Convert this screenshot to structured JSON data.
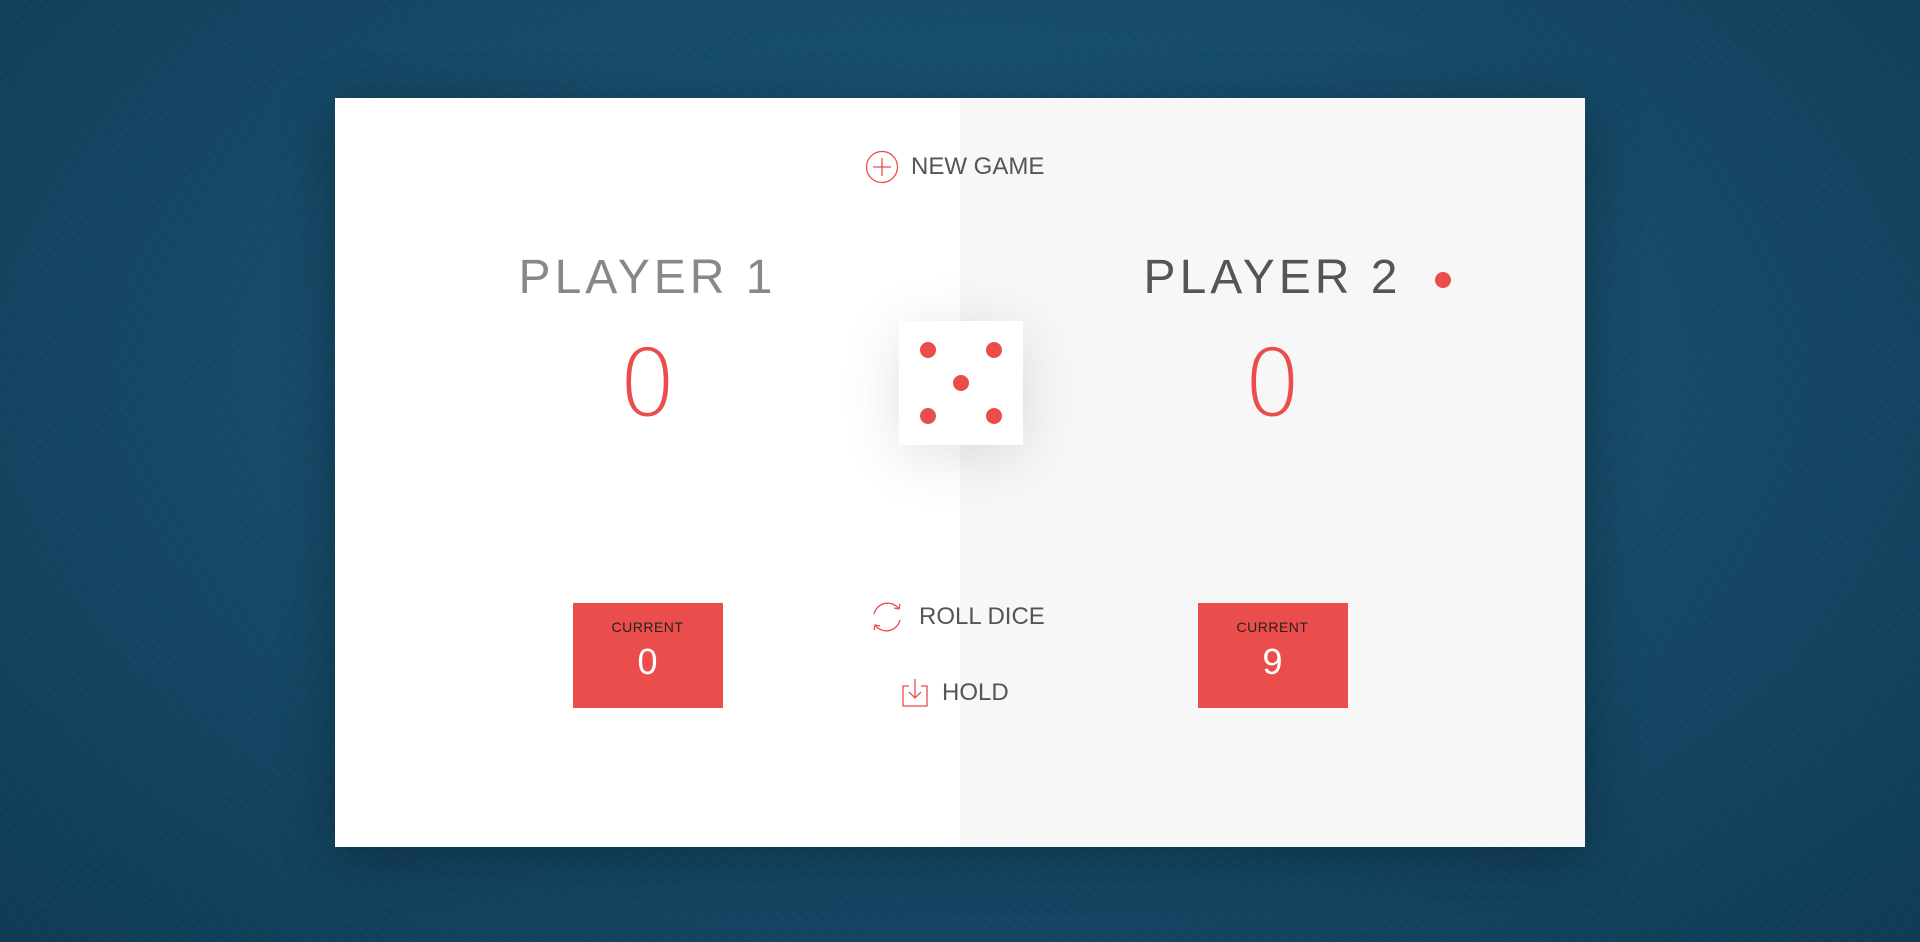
{
  "buttons": {
    "new_game": "New game",
    "roll_dice": "Roll dice",
    "hold": "Hold"
  },
  "players": [
    {
      "name": "Player 1",
      "score": "0",
      "current_label": "Current",
      "current_score": "0",
      "active": false
    },
    {
      "name": "Player 2",
      "score": "0",
      "current_label": "Current",
      "current_score": "9",
      "active": true
    }
  ],
  "dice": {
    "value": 5
  },
  "colors": {
    "accent": "#EB4D4D",
    "background": "#164C6B",
    "active_panel": "#F7F7F7",
    "inactive_panel": "#FFFFFF"
  },
  "icons": {
    "new_game": "circle-plus-icon",
    "roll_dice": "refresh-icon",
    "hold": "download-icon",
    "active_player": "active-dot-icon"
  }
}
